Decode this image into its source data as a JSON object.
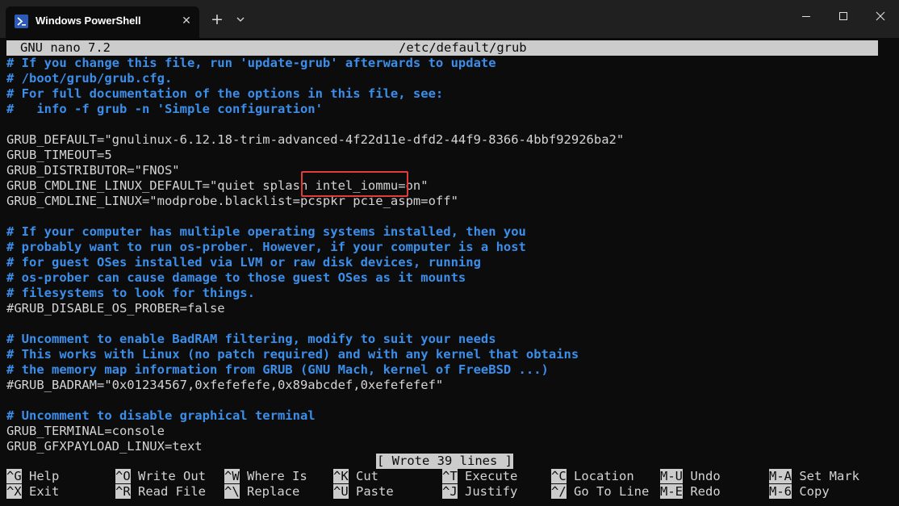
{
  "window": {
    "tab_title": "Windows PowerShell",
    "close_glyph": "✕",
    "new_tab_glyph": "+"
  },
  "nano": {
    "version": "GNU nano 7.2",
    "filename": "/etc/default/grub",
    "status": "[ Wrote 39 lines ]"
  },
  "lines": [
    {
      "text": "# If you change this file, run 'update-grub' afterwards to update",
      "kind": "comment"
    },
    {
      "text": "# /boot/grub/grub.cfg.",
      "kind": "comment"
    },
    {
      "text": "# For full documentation of the options in this file, see:",
      "kind": "comment"
    },
    {
      "text": "#   info -f grub -n 'Simple configuration'",
      "kind": "comment"
    },
    {
      "text": "",
      "kind": "plain"
    },
    {
      "text": "GRUB_DEFAULT=\"gnulinux-6.12.18-trim-advanced-4f22d11e-dfd2-44f9-8366-4bbf92926ba2\"",
      "kind": "plain"
    },
    {
      "text": "GRUB_TIMEOUT=5",
      "kind": "plain"
    },
    {
      "text": "GRUB_DISTRIBUTOR=\"FNOS\"",
      "kind": "plain"
    },
    {
      "text": "GRUB_CMDLINE_LINUX_DEFAULT=\"quiet splash intel_iommu=on\"",
      "kind": "plain"
    },
    {
      "text": "GRUB_CMDLINE_LINUX=\"modprobe.blacklist=pcspkr pcie_aspm=off\"",
      "kind": "plain"
    },
    {
      "text": "",
      "kind": "plain"
    },
    {
      "text": "# If your computer has multiple operating systems installed, then you",
      "kind": "comment"
    },
    {
      "text": "# probably want to run os-prober. However, if your computer is a host",
      "kind": "comment"
    },
    {
      "text": "# for guest OSes installed via LVM or raw disk devices, running",
      "kind": "comment"
    },
    {
      "text": "# os-prober can cause damage to those guest OSes as it mounts",
      "kind": "comment"
    },
    {
      "text": "# filesystems to look for things.",
      "kind": "comment"
    },
    {
      "text": "#GRUB_DISABLE_OS_PROBER=false",
      "kind": "plain"
    },
    {
      "text": "",
      "kind": "plain"
    },
    {
      "text": "# Uncomment to enable BadRAM filtering, modify to suit your needs",
      "kind": "comment"
    },
    {
      "text": "# This works with Linux (no patch required) and with any kernel that obtains",
      "kind": "comment"
    },
    {
      "text": "# the memory map information from GRUB (GNU Mach, kernel of FreeBSD ...)",
      "kind": "comment"
    },
    {
      "text": "#GRUB_BADRAM=\"0x01234567,0xfefefefe,0x89abcdef,0xefefefef\"",
      "kind": "plain"
    },
    {
      "text": "",
      "kind": "plain"
    },
    {
      "text": "# Uncomment to disable graphical terminal",
      "kind": "comment"
    },
    {
      "text": "GRUB_TERMINAL=console",
      "kind": "plain"
    },
    {
      "text": "GRUB_GFXPAYLOAD_LINUX=text",
      "kind": "plain"
    }
  ],
  "shortcuts": [
    [
      {
        "key": "^G",
        "label": "Help"
      },
      {
        "key": "^O",
        "label": "Write Out"
      },
      {
        "key": "^W",
        "label": "Where Is"
      },
      {
        "key": "^K",
        "label": "Cut"
      },
      {
        "key": "^T",
        "label": "Execute"
      },
      {
        "key": "^C",
        "label": "Location"
      },
      {
        "key": "M-U",
        "label": "Undo"
      },
      {
        "key": "M-A",
        "label": "Set Mark"
      }
    ],
    [
      {
        "key": "^X",
        "label": "Exit"
      },
      {
        "key": "^R",
        "label": "Read File"
      },
      {
        "key": "^\\",
        "label": "Replace"
      },
      {
        "key": "^U",
        "label": "Paste"
      },
      {
        "key": "^J",
        "label": "Justify"
      },
      {
        "key": "^/",
        "label": "Go To Line"
      },
      {
        "key": "M-E",
        "label": "Redo"
      },
      {
        "key": "M-6",
        "label": "Copy"
      }
    ]
  ],
  "colors": {
    "comment": "#3b8eea",
    "text": "#d4d4d4",
    "background": "#0c0c0c",
    "highlight_box": "#e03c3c"
  },
  "icons": {
    "tab_icon": "powershell-icon",
    "tab_dropdown": "chevron-down-icon",
    "minimize": "minimize-icon",
    "maximize": "maximize-icon",
    "close": "close-icon"
  }
}
